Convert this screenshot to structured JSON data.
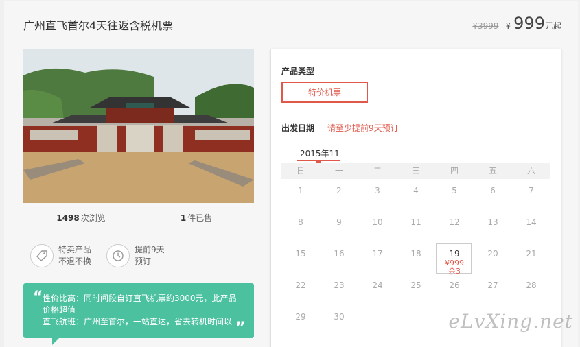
{
  "product": {
    "title": "广州直飞首尔4天往返含税机票",
    "old_price": "¥3999",
    "currency": "¥",
    "price": "999",
    "price_unit": "元起"
  },
  "stats": {
    "views_count": "1498",
    "views_label": "次浏览",
    "sold_count": "1",
    "sold_label": "件已售"
  },
  "features": [
    {
      "icon": "tag-icon",
      "line1": "特卖产品",
      "line2": "不退不换"
    },
    {
      "icon": "clock-icon",
      "line1": "提前9天",
      "line2": "预订"
    }
  ],
  "notes": {
    "open_quote": "“",
    "close_quote": "„",
    "line1": "性价比高：同时间段自订直飞机票约3000元，此产品",
    "line1b": "价格超值",
    "line2": "直飞航班：广州至首尔，一站直达，省去转机时间以"
  },
  "booking": {
    "product_type_label": "产品类型",
    "product_type_option": "特价机票",
    "departure_label": "出发日期",
    "departure_hint": "请至少提前9天预订",
    "month": "2015年11",
    "weekdays": [
      "日",
      "一",
      "二",
      "三",
      "四",
      "五",
      "六"
    ],
    "weeks": [
      [
        "1",
        "2",
        "3",
        "4",
        "5",
        "6",
        "7"
      ],
      [
        "8",
        "9",
        "10",
        "11",
        "12",
        "13",
        "14"
      ],
      [
        "15",
        "16",
        "17",
        "18",
        "19",
        "20",
        "21"
      ],
      [
        "22",
        "23",
        "24",
        "25",
        "26",
        "27",
        "28"
      ],
      [
        "29",
        "30",
        "",
        "",
        "",
        "",
        ""
      ]
    ],
    "selected": {
      "day": "19",
      "price": "¥999",
      "remaining": "余3"
    }
  },
  "watermark": "eLvXing.net",
  "colors": {
    "accent": "#e0584a",
    "note_bg": "#4bc1a0"
  }
}
